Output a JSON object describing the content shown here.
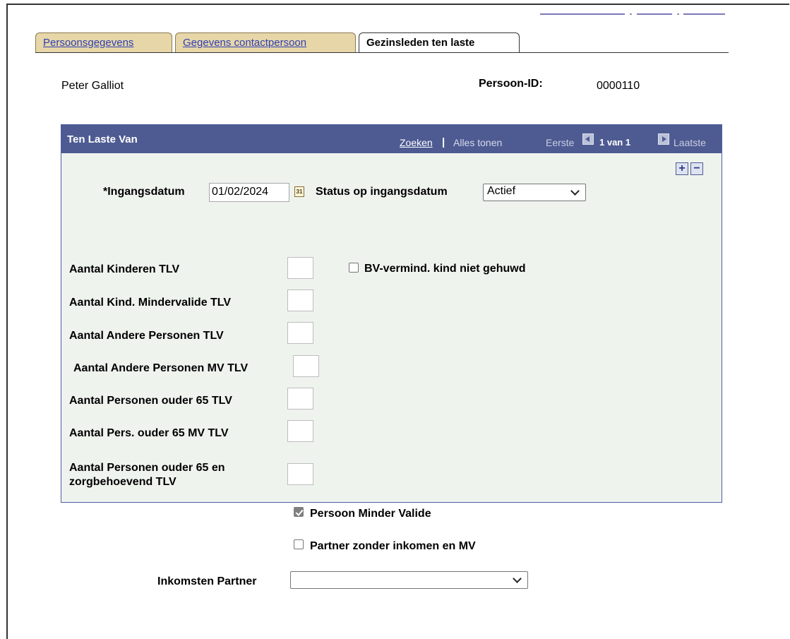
{
  "tabs": [
    {
      "label": "Persoonsgegevens",
      "active": false
    },
    {
      "label": "Gegevens contactpersoon",
      "active": false
    },
    {
      "label": "Gezinsleden ten laste",
      "active": true
    }
  ],
  "person": {
    "name": "Peter Galliot",
    "id_label": "Persoon-ID:",
    "id_value": "0000110"
  },
  "panel": {
    "title": "Ten Laste Van",
    "zoeken": "Zoeken",
    "separator": "|",
    "alles_tonen": "Alles tonen",
    "eerste": "Eerste",
    "count": "1 van 1",
    "laatste": "Laatste",
    "add_icon": "+",
    "remove_icon": "−"
  },
  "form": {
    "ingangsdatum_label": "*Ingangsdatum",
    "ingangsdatum_value": "01/02/2024",
    "calendar_icon_text": "31",
    "status_label": "Status op ingangsdatum",
    "status_value": "Actief",
    "kinderen_label": "Aantal Kinderen TLV",
    "kind_mindervalide_label": "Aantal Kind. Mindervalide TLV",
    "andere_personen_label": "Aantal Andere Personen TLV",
    "andere_personen_mv_label": "Aantal Andere Personen MV TLV",
    "personen_65_label": "Aantal Personen ouder 65 TLV",
    "pers_65_mv_label": "Aantal Pers. ouder 65 MV TLV",
    "personen_65_zorg_label_line1": "Aantal Personen ouder 65 en",
    "personen_65_zorg_label_line2": "zorgbehoevend TLV",
    "bv_vermind_label": "BV-vermind. kind niet gehuwd",
    "bv_vermind_checked": false,
    "persoon_minder_valide_label": "Persoon Minder Valide",
    "persoon_minder_valide_checked": true,
    "partner_zonder_inkomen_label": "Partner zonder inkomen en MV",
    "partner_zonder_inkomen_checked": false,
    "inkomsten_partner_label": "Inkomsten Partner",
    "inkomsten_partner_value": ""
  },
  "colors": {
    "header_bg": "#4e5b92",
    "panel_bg": "#eef3ee",
    "tab_bg": "#e7d6a8",
    "link": "#2d3fb5"
  }
}
